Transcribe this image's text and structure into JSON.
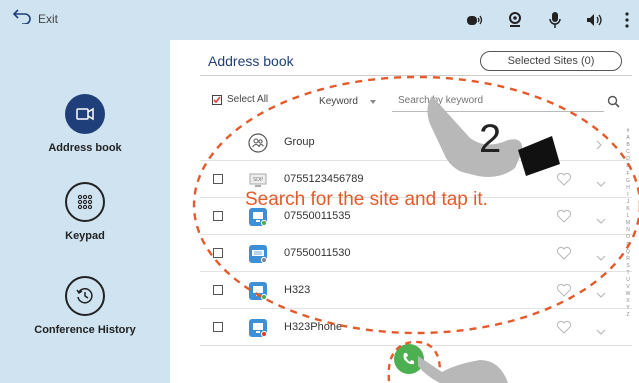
{
  "topbar": {
    "exit_label": "Exit",
    "icons": [
      "camera-icon",
      "webcam-icon",
      "microphone-icon",
      "speaker-icon",
      "more-vertical-icon"
    ]
  },
  "sidebar": {
    "items": [
      {
        "label": "Address book",
        "icon": "address-book-icon",
        "active": true
      },
      {
        "label": "Keypad",
        "icon": "keypad-icon",
        "active": false
      },
      {
        "label": "Conference History",
        "icon": "history-icon",
        "active": false
      }
    ]
  },
  "main": {
    "title": "Address book",
    "selected_sites_label": "Selected Sites (0)",
    "select_all_label": "Select All",
    "keyword_label": "Keyword",
    "search_placeholder": "Search by keyword",
    "group_label": "Group",
    "contacts": [
      {
        "name": "0755123456789",
        "icon": "sdp-icon"
      },
      {
        "name": "07550011535",
        "icon": "terminal-icon"
      },
      {
        "name": "07550011530",
        "icon": "mcu-icon"
      },
      {
        "name": "H323",
        "icon": "terminal-icon"
      },
      {
        "name": "H323Phone",
        "icon": "terminal-icon"
      }
    ],
    "alphabet": "#ABCDEFGHIJKLMNOPQRSTUVWXYZ"
  },
  "overlay": {
    "instruction": "Search for the site and tap it.",
    "step_number": "2"
  },
  "colors": {
    "sidebar_bg": "#cfe3f1",
    "accent": "#1f3f7a",
    "highlight": "#e55a2b",
    "call_green": "#4caf50"
  }
}
